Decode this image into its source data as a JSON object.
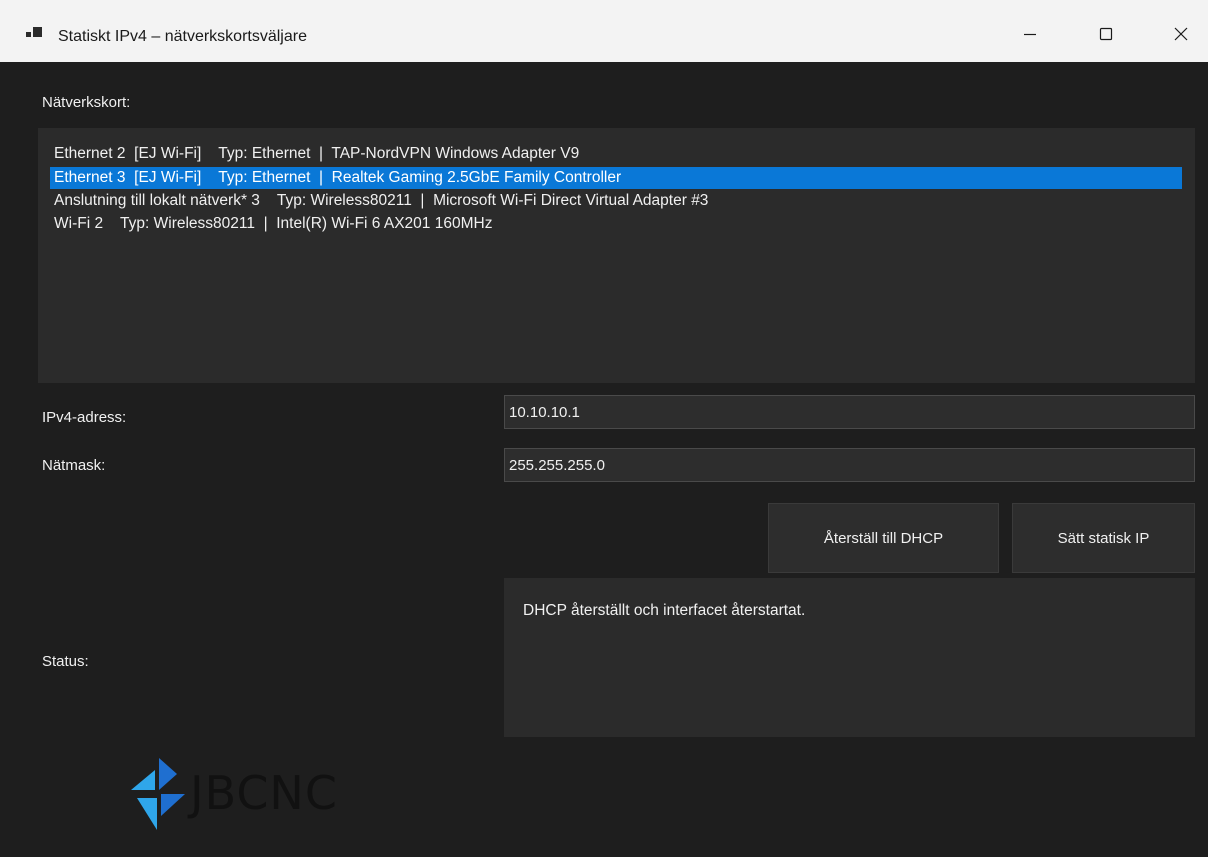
{
  "window": {
    "title": "Statiskt IPv4 – nätverkskortsväljare",
    "icon": "app-window-icon",
    "controls": [
      "minimize-icon",
      "maximize-icon",
      "close-icon"
    ]
  },
  "adapters": {
    "label": "Nätverkskort:",
    "items": [
      "Ethernet 2  [EJ Wi-Fi]    Typ: Ethernet  |  TAP-NordVPN Windows Adapter V9",
      "Ethernet 3  [EJ Wi-Fi]    Typ: Ethernet  |  Realtek Gaming 2.5GbE Family Controller",
      "Anslutning till lokalt nätverk* 3    Typ: Wireless80211  |  Microsoft Wi-Fi Direct Virtual Adapter #3",
      "Wi-Fi 2    Typ: Wireless80211  |  Intel(R) Wi-Fi 6 AX201 160MHz"
    ],
    "selected_index": 1
  },
  "ipv4": {
    "label": "IPv4-adress:",
    "value": "10.10.10.1"
  },
  "netmask": {
    "label": "Nätmask:",
    "value": "255.255.255.0"
  },
  "buttons": {
    "dhcp": "Återställ till DHCP",
    "static": "Sätt statisk IP"
  },
  "status": {
    "label": "Status:",
    "text": "DHCP återställt och interfacet återstartat."
  },
  "logo": {
    "text": "JBCNC",
    "colors": [
      "#1f6fd0",
      "#2fa6ea"
    ]
  },
  "colors": {
    "accent": "#0a78d7",
    "background": "#1e1e1e",
    "titlebar": "#f3f3f3"
  }
}
